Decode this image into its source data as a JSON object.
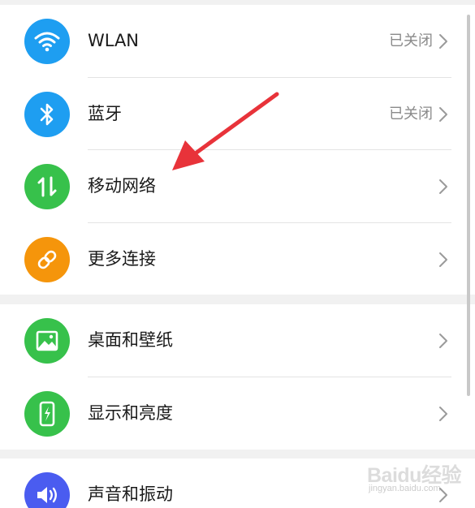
{
  "settings": {
    "groups": [
      {
        "items": [
          {
            "label": "WLAN",
            "status": "已关闭",
            "icon": "wifi-icon",
            "color": "#1e9ef1"
          },
          {
            "label": "蓝牙",
            "status": "已关闭",
            "icon": "bluetooth-icon",
            "color": "#1e9ef1"
          },
          {
            "label": "移动网络",
            "status": "",
            "icon": "mobile-data-icon",
            "color": "#37c14b"
          },
          {
            "label": "更多连接",
            "status": "",
            "icon": "link-icon",
            "color": "#f5950b"
          }
        ]
      },
      {
        "items": [
          {
            "label": "桌面和壁纸",
            "status": "",
            "icon": "wallpaper-icon",
            "color": "#37c14b"
          },
          {
            "label": "显示和亮度",
            "status": "",
            "icon": "display-icon",
            "color": "#37c14b"
          }
        ]
      },
      {
        "items": [
          {
            "label": "声音和振动",
            "status": "",
            "icon": "sound-icon",
            "color": "#4a5cf0"
          }
        ]
      }
    ]
  },
  "annotation": {
    "arrow_color": "#e8333a",
    "arrow_target": "移动网络"
  },
  "watermark": {
    "brand": "Baidu经验",
    "url": "jingyan.baidu.com"
  }
}
